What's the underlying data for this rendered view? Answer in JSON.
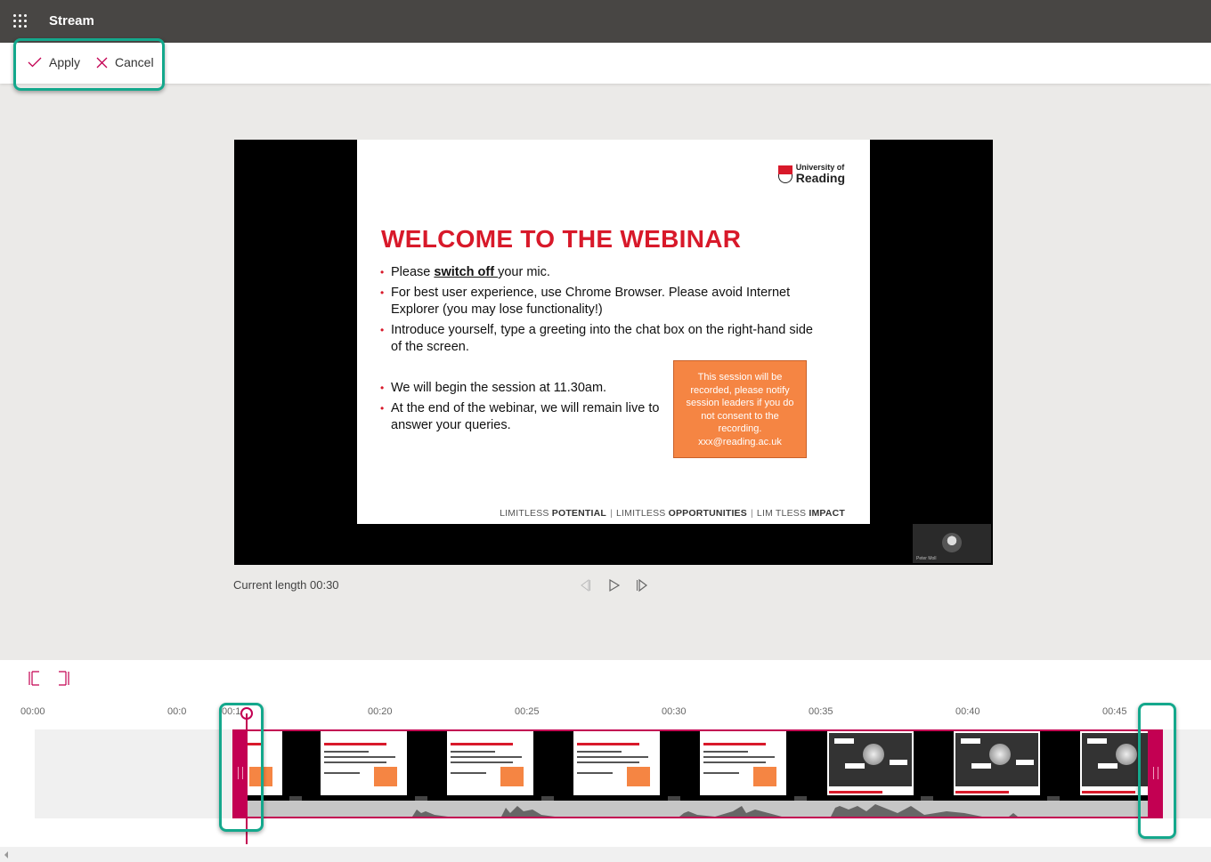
{
  "app": {
    "title": "Stream"
  },
  "toolbar": {
    "apply_label": "Apply",
    "cancel_label": "Cancel"
  },
  "colors": {
    "accent": "#c30052",
    "topbar": "#484644",
    "highlight": "#14a88c",
    "slide_red": "#d8192a",
    "notice_orange": "#f58543"
  },
  "slide": {
    "logo_line1": "University of",
    "logo_line2": "Reading",
    "title": "WELCOME TO THE WEBINAR",
    "bullet1_pre": "Please ",
    "bullet1_bold": "switch off ",
    "bullet1_post": "your mic.",
    "bullet2": "For best user experience, use Chrome Browser. Please avoid Internet Explorer (you may lose functionality!)",
    "bullet3": "Introduce yourself, type a greeting into the chat box on the right-hand side of the screen.",
    "bullet4": "We will begin the session at 11.30am.",
    "bullet5": "At the end of the webinar, we will remain live to answer your queries.",
    "notice": "This session will be recorded, please notify session leaders if you do not consent to the recording. xxx@reading.ac.uk",
    "tagline": [
      {
        "light": "LIMITLESS ",
        "bold": "POTENTIAL"
      },
      {
        "light": "LIMITLESS ",
        "bold": "OPPORTUNITIES"
      },
      {
        "light": "LIM TLESS ",
        "bold": "IMPACT"
      }
    ],
    "participant_name": "Peter Moll"
  },
  "player": {
    "current_length_label": "Current length 00:30",
    "controls": [
      "previous-frame",
      "play",
      "next-frame"
    ]
  },
  "timeline": {
    "ruler": [
      "00:00",
      "00:0",
      "00:1",
      "00:20",
      "00:25",
      "00:30",
      "00:35",
      "00:40",
      "00:45"
    ],
    "trim_start_icon": "trim-start-icon",
    "trim_end_icon": "trim-end-icon"
  }
}
